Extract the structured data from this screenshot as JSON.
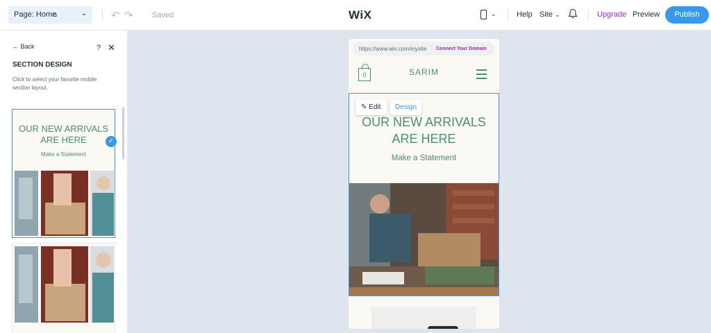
{
  "topbar": {
    "page_label": "Page: Home",
    "saved": "Saved",
    "logo": "WiX",
    "help": "Help",
    "site": "Site",
    "upgrade": "Upgrade",
    "preview": "Preview",
    "publish": "Publish",
    "accent": "#3899ec",
    "upgrade_color": "#9a27d5"
  },
  "panel": {
    "back": "Back",
    "title": "SECTION DESIGN",
    "description": "Click to select your favorite mobile section layout.",
    "options": [
      {
        "heading": "OUR NEW ARRIVALS ARE HERE",
        "sub": "Make a Statement",
        "selected": true
      },
      {
        "heading": "",
        "sub": "",
        "selected": false
      }
    ]
  },
  "phone": {
    "url": "https://www.wix.com/mysite",
    "connect": "Connect Your Domain",
    "cart_count": "0",
    "site_name": "SARIM",
    "edit": "Edit",
    "design": "Design",
    "hero_heading": "OUR NEW ARRIVALS ARE HERE",
    "hero_sub": "Make a Statement",
    "brand_color": "#4c8b79"
  }
}
